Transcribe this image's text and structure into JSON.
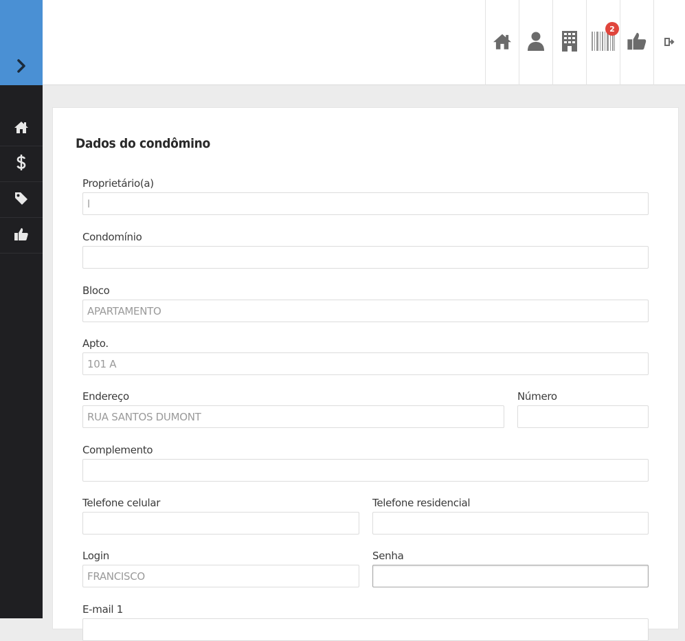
{
  "sidebar": {
    "toggle_icon": "chevron-right-icon",
    "items": [
      {
        "name": "home",
        "icon": "home-icon"
      },
      {
        "name": "financeiro",
        "icon": "dollar-icon"
      },
      {
        "name": "tags",
        "icon": "tag-icon"
      },
      {
        "name": "likes",
        "icon": "thumbs-up-icon"
      }
    ]
  },
  "topbar": {
    "icons": [
      {
        "name": "home",
        "icon": "home-icon"
      },
      {
        "name": "user",
        "icon": "user-icon"
      },
      {
        "name": "building",
        "icon": "building-icon"
      },
      {
        "name": "barcode",
        "icon": "barcode-icon",
        "badge": "2"
      },
      {
        "name": "thumbs-up",
        "icon": "thumbs-up-icon"
      },
      {
        "name": "logout",
        "icon": "sign-out-icon"
      }
    ]
  },
  "form": {
    "title": "Dados do condômino",
    "proprietario": {
      "label": "Proprietário(a)",
      "value": "l"
    },
    "condominio": {
      "label": "Condomínio",
      "value": ""
    },
    "bloco": {
      "label": "Bloco",
      "value": "APARTAMENTO"
    },
    "apto": {
      "label": "Apto.",
      "value": "101 A"
    },
    "endereco": {
      "label": "Endereço",
      "value": "RUA SANTOS DUMONT"
    },
    "numero": {
      "label": "Número",
      "value": ""
    },
    "complemento": {
      "label": "Complemento",
      "value": ""
    },
    "tel_celular": {
      "label": "Telefone celular",
      "value": ""
    },
    "tel_residencial": {
      "label": "Telefone residencial",
      "value": ""
    },
    "login": {
      "label": "Login",
      "value": "FRANCISCO"
    },
    "senha": {
      "label": "Senha",
      "value": ""
    },
    "email1": {
      "label": "E-mail 1",
      "value": ""
    }
  },
  "colors": {
    "sidebar_bg": "#1f1f22",
    "sidebar_toggle_bg": "#4a90d4",
    "badge_bg": "#e0453c",
    "topbar_icon": "#6b6b6b"
  }
}
